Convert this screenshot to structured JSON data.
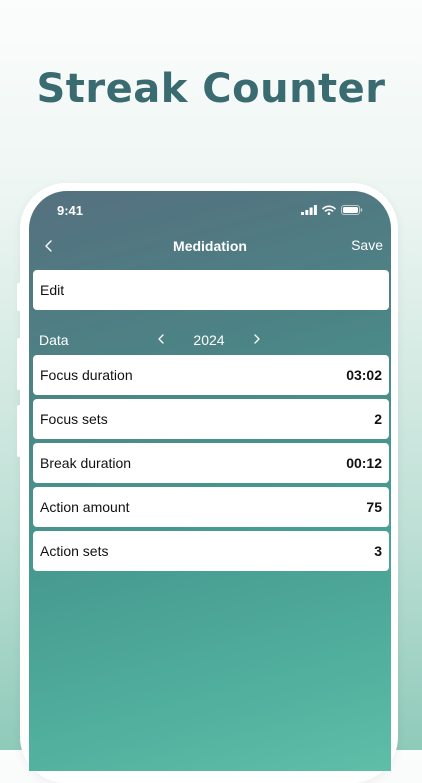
{
  "headline": "Streak Counter",
  "status_bar": {
    "time": "9:41",
    "icons": [
      "cellular-signal-icon",
      "wifi-icon",
      "battery-icon"
    ]
  },
  "nav": {
    "back_icon": "chevron-left-icon",
    "title": "Medidation",
    "save_label": "Save"
  },
  "edit": {
    "label": "Edit"
  },
  "data_section": {
    "label": "Data",
    "prev_icon": "chevron-left-icon",
    "year": "2024",
    "next_icon": "chevron-right-icon"
  },
  "stats": [
    {
      "label": "Focus duration",
      "value": "03:02"
    },
    {
      "label": "Focus sets",
      "value": "2"
    },
    {
      "label": "Break duration",
      "value": "00:12"
    },
    {
      "label": "Action amount",
      "value": "75"
    },
    {
      "label": "Action sets",
      "value": "3"
    }
  ],
  "colors": {
    "headline": "#3a6b70",
    "screen_top": "#55707f",
    "screen_bottom": "#5fbea8",
    "card_background": "#ffffff"
  }
}
